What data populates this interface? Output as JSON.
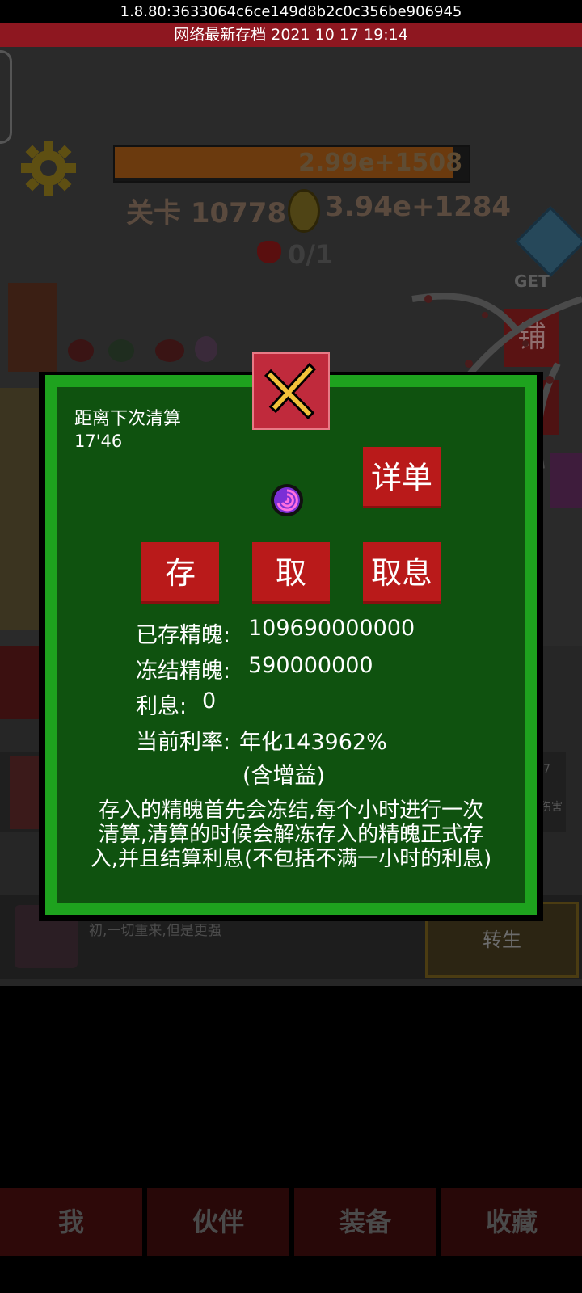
{
  "header": {
    "version": "1.8.80:3633064c6ce149d8b2c0c356be906945",
    "cloud_save": "网络最新存档  2021  10  17  19:14"
  },
  "game": {
    "hp_value": "2.99e+1508",
    "stage_label": "关卡 10778",
    "coins": "3.94e+1284",
    "boss_count": "0/1",
    "get_label": "GET",
    "shop_label": "铺",
    "rebirth_desc": "初,一切重来,但是更强",
    "rebirth_button": "转生",
    "row_damage_label": "伤害",
    "row_seven": "7"
  },
  "nav": {
    "me": "我",
    "partner": "伙伴",
    "equipment": "装备",
    "collection": "收藏"
  },
  "bank": {
    "timer_label": "距离下次清算",
    "timer_value": "17'46",
    "detail_button": "详单",
    "deposit_button": "存",
    "withdraw_button": "取",
    "withdraw_interest_button": "取息",
    "saved_label": "已存精魄:",
    "saved_value": "109690000000",
    "frozen_label": "冻结精魄:",
    "frozen_value": "590000000",
    "interest_label": "利息:",
    "interest_value": "0",
    "rate_label": "当前利率:",
    "rate_value": "年化143962%",
    "bonus_note": "(含增益)",
    "description": "存入的精魄首先会冻结,每个小时进行一次清算,清算的时候会解冻存入的精魄正式存入,并且结算利息(不包括不满一小时的利息)"
  },
  "colors": {
    "modal_frame": "#1ea21e",
    "modal_panel": "#0f520f",
    "button_red": "#b91a1a",
    "close_button": "#c02a3c",
    "save_bar": "#8e1720"
  }
}
